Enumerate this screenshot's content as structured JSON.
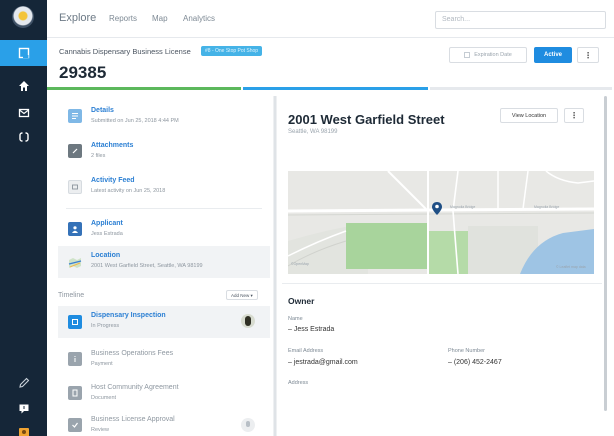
{
  "nav": {
    "brand": "Explore",
    "tabs": [
      "Reports",
      "Map",
      "Analytics"
    ],
    "search_placeholder": "Search..."
  },
  "rail": {
    "items": [
      "records-icon",
      "team-icon",
      "inbox-icon",
      "sync-icon"
    ],
    "bottom": [
      "edit-icon",
      "comment-icon",
      "user-avatar"
    ]
  },
  "record": {
    "type_label": "Cannabis Dispensary Business License",
    "tag": "#8 - One Stop Pot Shop",
    "id": "29385",
    "expiration_label": "Expiration Date",
    "status_button": "Active",
    "more": "⋮"
  },
  "colors": {
    "accent": "#1f8ce0",
    "progress": [
      "#5cb85c",
      "#2aa0e8",
      "#e6e9ed"
    ]
  },
  "sidebar": {
    "details": {
      "title": "Details",
      "subtitle": "Submitted on Jun 25, 2018 4:44 PM"
    },
    "attachments": {
      "title": "Attachments",
      "subtitle": "2 files"
    },
    "activity": {
      "title": "Activity Feed",
      "subtitle": "Latest activity on Jun 25, 2018"
    },
    "applicant": {
      "title": "Applicant",
      "subtitle": "Jess Estrada"
    },
    "location": {
      "title": "Location",
      "subtitle": "2001 West Garfield Street, Seattle, WA 98199"
    },
    "timeline_label": "Timeline",
    "add_new": "Add New ▾",
    "timeline": [
      {
        "title": "Dispensary Inspection",
        "subtitle": "In Progress"
      },
      {
        "title": "Business Operations Fees",
        "subtitle": "Payment"
      },
      {
        "title": "Host Community Agreement",
        "subtitle": "Document"
      },
      {
        "title": "Business License Approval",
        "subtitle": "Review"
      }
    ]
  },
  "location_panel": {
    "title": "2001 West Garfield Street",
    "subtitle": "Seattle, WA 98199",
    "view_button": "View Location",
    "more": "⋮",
    "map_credit_left": "©OpenMap",
    "map_credit_right": "© Leaflet map data",
    "street_1": "Magnolia Bridge",
    "street_2": "Magnolia Bridge"
  },
  "owner": {
    "heading": "Owner",
    "name_label": "Name",
    "name_value": "– Jess Estrada",
    "email_label": "Email Address",
    "email_value": "– jestrada@gmail.com",
    "phone_label": "Phone Number",
    "phone_value": "– (206) 452-2467",
    "address_label": "Address"
  }
}
